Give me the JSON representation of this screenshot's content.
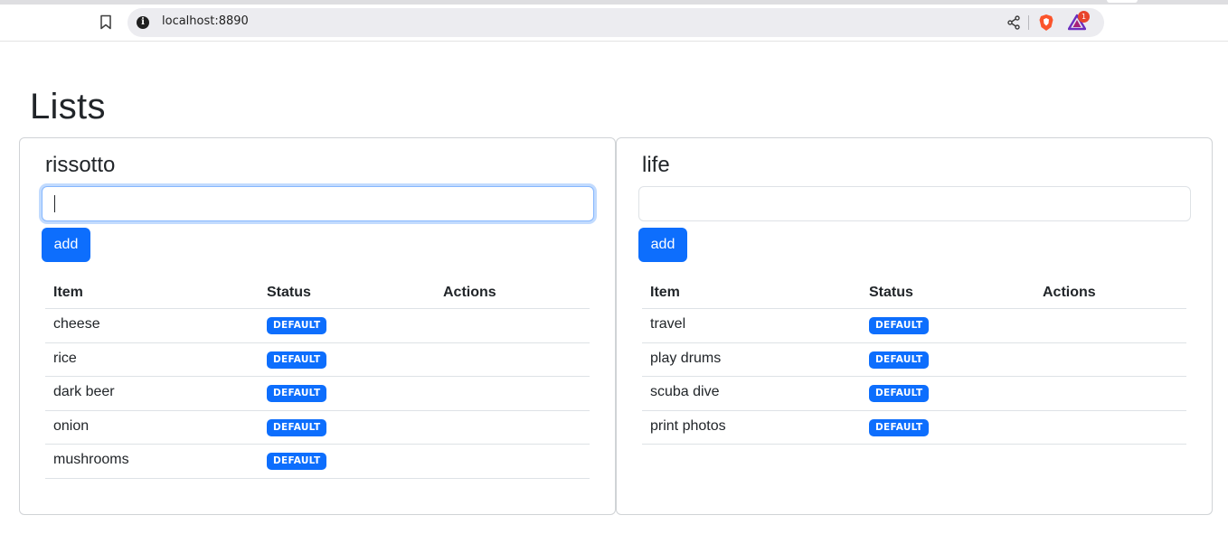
{
  "browser": {
    "url": "localhost:8890",
    "rewards_badge": "1"
  },
  "page": {
    "title": "Lists"
  },
  "lists": [
    {
      "name": "rissotto",
      "input_value": "",
      "add_label": "add",
      "columns": [
        "Item",
        "Status",
        "Actions"
      ],
      "rows": [
        {
          "item": "cheese",
          "status": "DEFAULT"
        },
        {
          "item": "rice",
          "status": "DEFAULT"
        },
        {
          "item": "dark beer",
          "status": "DEFAULT"
        },
        {
          "item": "onion",
          "status": "DEFAULT"
        },
        {
          "item": "mushrooms",
          "status": "DEFAULT"
        }
      ]
    },
    {
      "name": "life",
      "input_value": "",
      "add_label": "add",
      "columns": [
        "Item",
        "Status",
        "Actions"
      ],
      "rows": [
        {
          "item": "travel",
          "status": "DEFAULT"
        },
        {
          "item": "play drums",
          "status": "DEFAULT"
        },
        {
          "item": "scuba dive",
          "status": "DEFAULT"
        },
        {
          "item": "print photos",
          "status": "DEFAULT"
        }
      ]
    }
  ],
  "colors": {
    "primary": "#0d6efd",
    "text": "#212529",
    "border": "#dee2e6"
  }
}
